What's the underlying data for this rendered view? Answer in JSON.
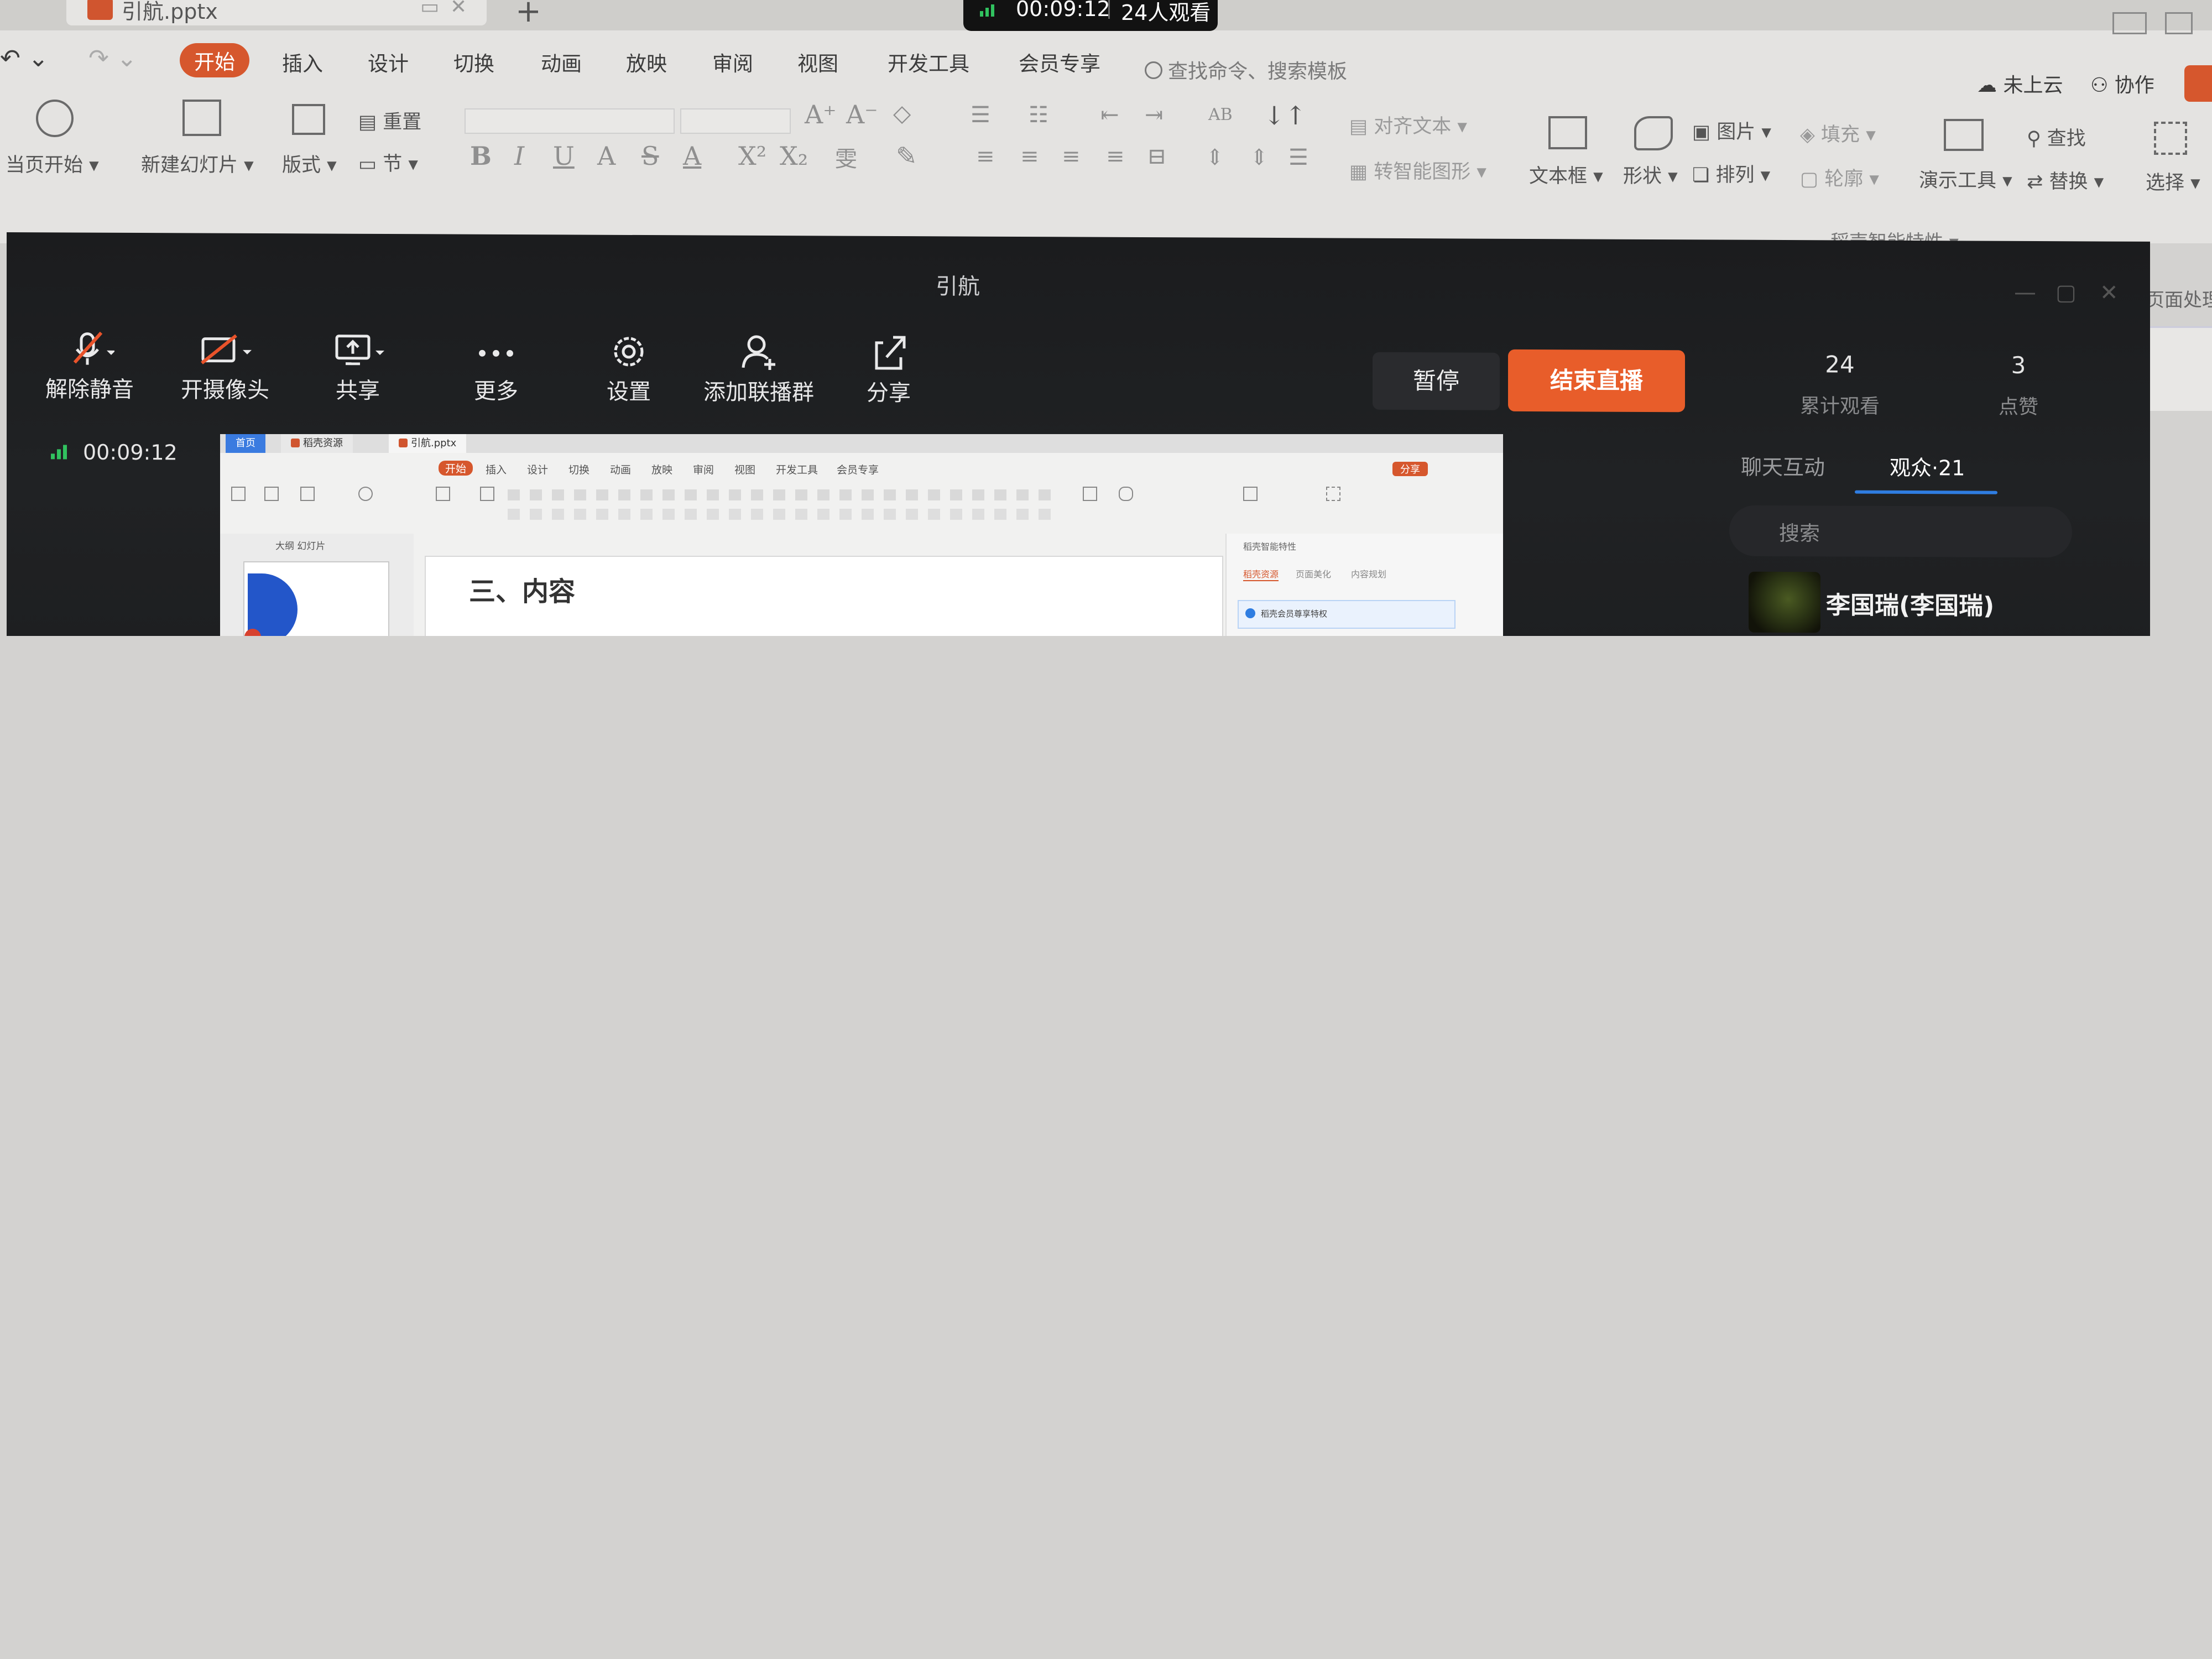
{
  "wps": {
    "file_tab": "引航.pptx",
    "menu": [
      "开始",
      "插入",
      "设计",
      "切换",
      "动画",
      "放映",
      "审阅",
      "视图",
      "开发工具",
      "会员专享"
    ],
    "search_hint": "查找命令、搜索模板",
    "cloud": "未上云",
    "collab": "协作",
    "ribbon": {
      "from_current": "当页开始",
      "new_slide": "新建幻灯片",
      "layout": "版式",
      "reset": "重置",
      "section": "节",
      "align_text": "对齐文本",
      "smart_art": "转智能图形",
      "textbox": "文本框",
      "shape": "形状",
      "picture": "图片",
      "arrange": "排列",
      "fill": "填充",
      "outline": "轮廓",
      "present_tools": "演示工具",
      "find": "查找",
      "replace": "替换",
      "select": "选择"
    },
    "smart_feature": "稻壳智能特性",
    "right_edge": "页面处理"
  },
  "pill": {
    "time": "00:09:12",
    "viewers": "24人观看"
  },
  "live": {
    "title": "引航",
    "controls": [
      "解除静音",
      "开摄像头",
      "共享",
      "更多",
      "设置",
      "添加联播群",
      "分享"
    ],
    "pause": "暂停",
    "end": "结束直播",
    "total_views": "24",
    "total_views_label": "累计观看",
    "likes": "3",
    "likes_label": "点赞",
    "elapsed": "00:09:12",
    "tabs": [
      "聊天互动",
      "观众·21"
    ],
    "search_placeholder": "搜索",
    "viewer_name": "李国瑞(李国瑞)"
  },
  "preview": {
    "tabs": [
      "首页",
      "稻壳资源",
      "引航.pptx"
    ],
    "menu": [
      "开始",
      "插入",
      "设计",
      "切换",
      "动画",
      "放映",
      "审阅",
      "视图",
      "开发工具",
      "会员专享"
    ],
    "share": "分享",
    "left_tabs": "大纲   幻灯片",
    "slide_title": "三、内容",
    "panel_head": "稻壳智能特性",
    "panel_tabs": [
      "稻壳资源",
      "页面美化",
      "内容规划"
    ],
    "panel_notice": "稻壳会员尊享特权"
  }
}
